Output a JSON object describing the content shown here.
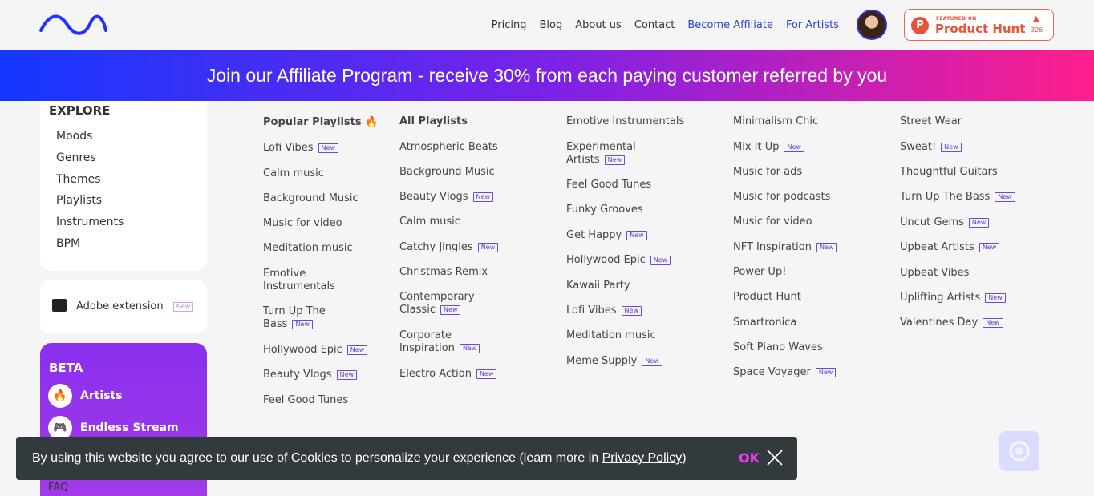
{
  "nav": {
    "links": [
      "Pricing",
      "Blog",
      "About us",
      "Contact",
      "Become Affiliate",
      "For Artists"
    ]
  },
  "producthunt": {
    "featured_label": "FEATURED ON",
    "name": "Product Hunt",
    "icon_letter": "P",
    "arrow": "▲",
    "count": "326"
  },
  "banner": {
    "text": "Join our Affiliate Program - receive 30% from each paying customer referred by you"
  },
  "sidebar": {
    "explore_title": "EXPLORE",
    "explore_items": [
      "Moods",
      "Genres",
      "Themes",
      "Playlists",
      "Instruments",
      "BPM"
    ],
    "adobe_label": "Adobe extension",
    "adobe_badge": "New",
    "beta_title": "BETA",
    "beta_items": [
      {
        "label": "Artists",
        "icon": "fire-icon",
        "glyph": "🔥"
      },
      {
        "label": "Endless Stream",
        "icon": "gamepad-icon",
        "glyph": "🎮"
      }
    ],
    "faq": "FAQ"
  },
  "columns": {
    "popular_header": "Popular Playlists",
    "popular_emoji": "🔥",
    "popular": [
      {
        "label": "Lofi Vibes",
        "new": "New"
      },
      {
        "label": "Calm music"
      },
      {
        "label": "Background Music"
      },
      {
        "label": "Music for video"
      },
      {
        "label": "Meditation music"
      },
      {
        "label": "Emotive",
        "label2": "Instrumentals"
      },
      {
        "label": "Turn Up The",
        "label2": "Bass",
        "new": "New"
      },
      {
        "label": "Hollywood Epic",
        "new": "New"
      },
      {
        "label": "Beauty Vlogs",
        "new": "New"
      },
      {
        "label": "Feel Good Tunes"
      }
    ],
    "all_header": "All Playlists",
    "all": [
      {
        "label": "Atmospheric Beats"
      },
      {
        "label": "Background Music"
      },
      {
        "label": "Beauty Vlogs",
        "new": "New"
      },
      {
        "label": "Calm music"
      },
      {
        "label": "Catchy Jingles",
        "new": "New"
      },
      {
        "label": "Christmas Remix"
      },
      {
        "label": "Contemporary",
        "label2": "Classic",
        "new": "New"
      },
      {
        "label": "Corporate",
        "label2": "Inspiration",
        "new": "New"
      },
      {
        "label": "Electro Action",
        "new": "New"
      }
    ],
    "col3": [
      {
        "label": "Emotive Instrumentals"
      },
      {
        "label": "Experimental",
        "label2": "Artists",
        "new": "New"
      },
      {
        "label": "Feel Good Tunes"
      },
      {
        "label": "Funky Grooves"
      },
      {
        "label": "Get Happy",
        "new": "New"
      },
      {
        "label": "Hollywood Epic",
        "new": "New"
      },
      {
        "label": "Kawaii Party"
      },
      {
        "label": "Lofi Vibes",
        "new": "New"
      },
      {
        "label": "Meditation music"
      },
      {
        "label": "Meme Supply",
        "new": "New"
      }
    ],
    "col4": [
      {
        "label": "Minimalism Chic"
      },
      {
        "label": "Mix It Up",
        "new": "New"
      },
      {
        "label": "Music for ads"
      },
      {
        "label": "Music for podcasts"
      },
      {
        "label": "Music for video"
      },
      {
        "label": "NFT Inspiration",
        "new": "New"
      },
      {
        "label": "Power Up!"
      },
      {
        "label": "Product Hunt"
      },
      {
        "label": "Smartronica"
      },
      {
        "label": "Soft Piano Waves"
      },
      {
        "label": "Space Voyager",
        "new": "New"
      }
    ],
    "col5": [
      {
        "label": "Street Wear"
      },
      {
        "label": "Sweat!",
        "new": "New"
      },
      {
        "label": "Thoughtful Guitars"
      },
      {
        "label": "Turn Up The Bass",
        "new": "New"
      },
      {
        "label": "Uncut Gems",
        "new": "New"
      },
      {
        "label": "Upbeat Artists",
        "new": "New"
      },
      {
        "label": "Upbeat Vibes"
      },
      {
        "label": "Uplifting Artists",
        "new": "New"
      },
      {
        "label": "Valentines Day",
        "new": "New"
      }
    ]
  },
  "cookie": {
    "text": "By using this website you agree to our use of Cookies to personalize your experience (learn more in ",
    "link": "Privacy Policy",
    "text_end": ")",
    "ok": "OK"
  },
  "colors": {
    "accent": "#2e3fcf",
    "banner_start": "#1338ff",
    "banner_end": "#ff1e8c",
    "beta_bg": "#8a2fee",
    "producthunt": "#e5533a"
  }
}
